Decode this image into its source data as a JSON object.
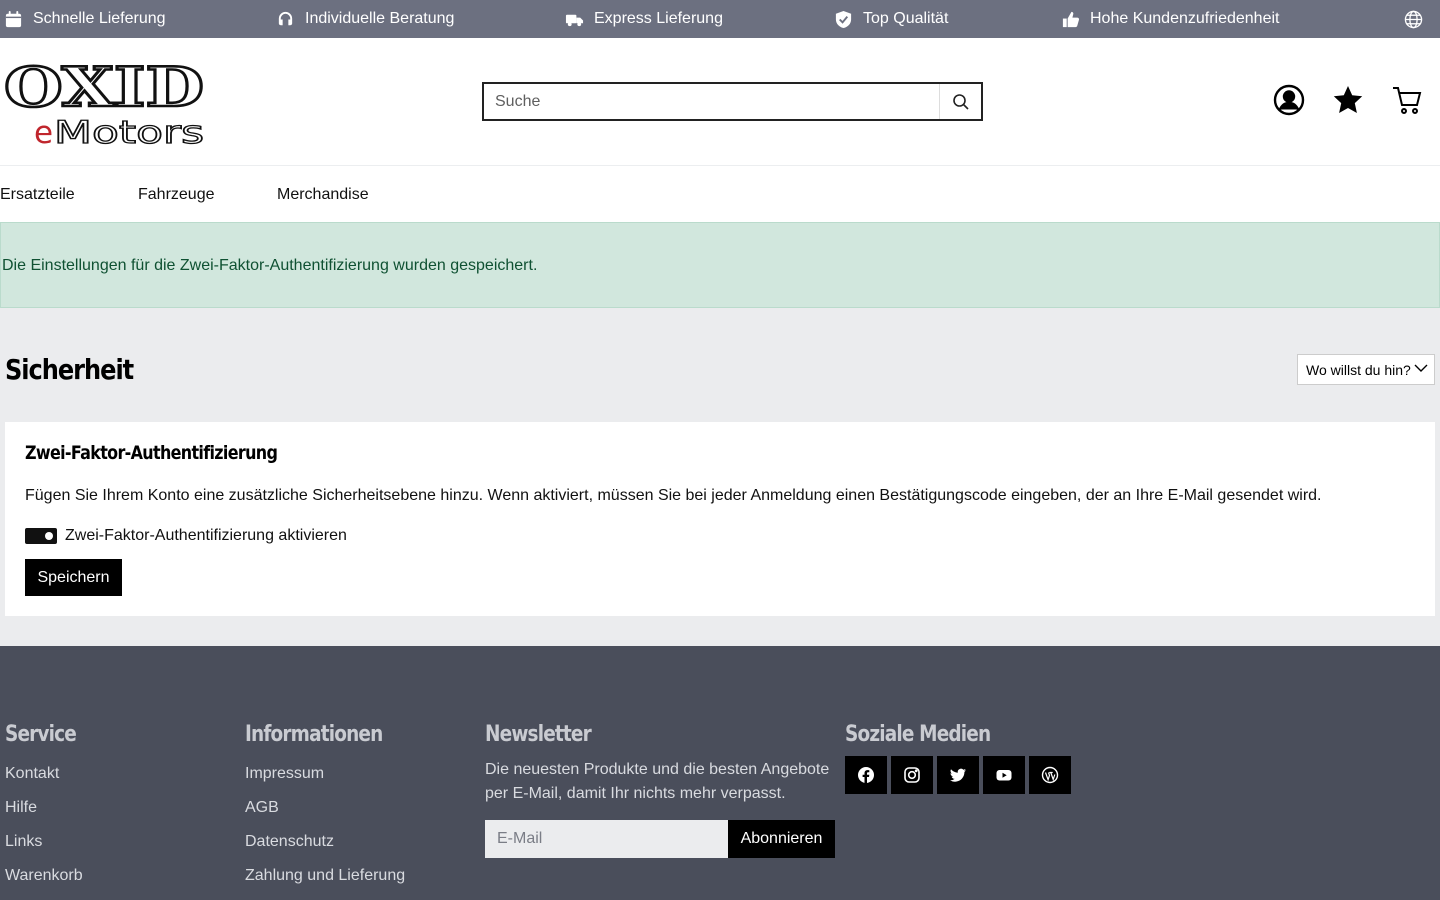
{
  "topbar": {
    "usps": [
      {
        "label": "Schnelle Lieferung",
        "icon": "calendar-icon"
      },
      {
        "label": "Individuelle Beratung",
        "icon": "headset-icon"
      },
      {
        "label": "Express Lieferung",
        "icon": "truck-icon"
      },
      {
        "label": "Top Qualität",
        "icon": "shield-check-icon"
      },
      {
        "label": "Hohe Kundenzufriedenheit",
        "icon": "thumbs-up-icon"
      }
    ],
    "language_icon": "globe-icon"
  },
  "header": {
    "logo_line1": "OXID",
    "logo_line2_a": "e",
    "logo_line2_b": "Motors",
    "search_placeholder": "Suche",
    "icons": [
      "user-icon",
      "star-icon",
      "cart-icon"
    ]
  },
  "nav": {
    "items": [
      "Ersatzteile",
      "Fahrzeuge",
      "Merchandise"
    ]
  },
  "alert": {
    "text": "Die Einstellungen für die Zwei-Faktor-Authentifizierung wurden gespeichert."
  },
  "page": {
    "title": "Sicherheit",
    "goto_label": "Wo willst du hin?"
  },
  "card": {
    "title": "Zwei-Faktor-Authentifizierung",
    "description": "Fügen Sie Ihrem Konto eine zusätzliche Sicherheitsebene hinzu. Wenn aktiviert, müssen Sie bei jeder Anmeldung einen Bestätigungscode eingeben, der an Ihre E-Mail gesendet wird.",
    "toggle_label": "Zwei-Faktor-Authentifizierung aktivieren",
    "toggle_on": true,
    "save_label": "Speichern"
  },
  "footer": {
    "service": {
      "title": "Service",
      "links": [
        "Kontakt",
        "Hilfe",
        "Links",
        "Warenkorb"
      ]
    },
    "info": {
      "title": "Informationen",
      "links": [
        "Impressum",
        "AGB",
        "Datenschutz",
        "Zahlung und Lieferung"
      ]
    },
    "newsletter": {
      "title": "Newsletter",
      "text": "Die neuesten Produkte und die besten Angebote per E-Mail, damit Ihr nichts mehr verpasst.",
      "email_placeholder": "E-Mail",
      "subscribe_label": "Abonnieren"
    },
    "social": {
      "title": "Soziale Medien",
      "icons": [
        "facebook-icon",
        "instagram-icon",
        "twitter-icon",
        "youtube-icon",
        "wordpress-icon"
      ]
    }
  },
  "colors": {
    "topbar_bg": "#6c7080",
    "footer_bg": "#4a4e5b",
    "alert_bg": "#d1e7dd",
    "alert_text": "#0f5132",
    "logo_red": "#c0262d"
  }
}
